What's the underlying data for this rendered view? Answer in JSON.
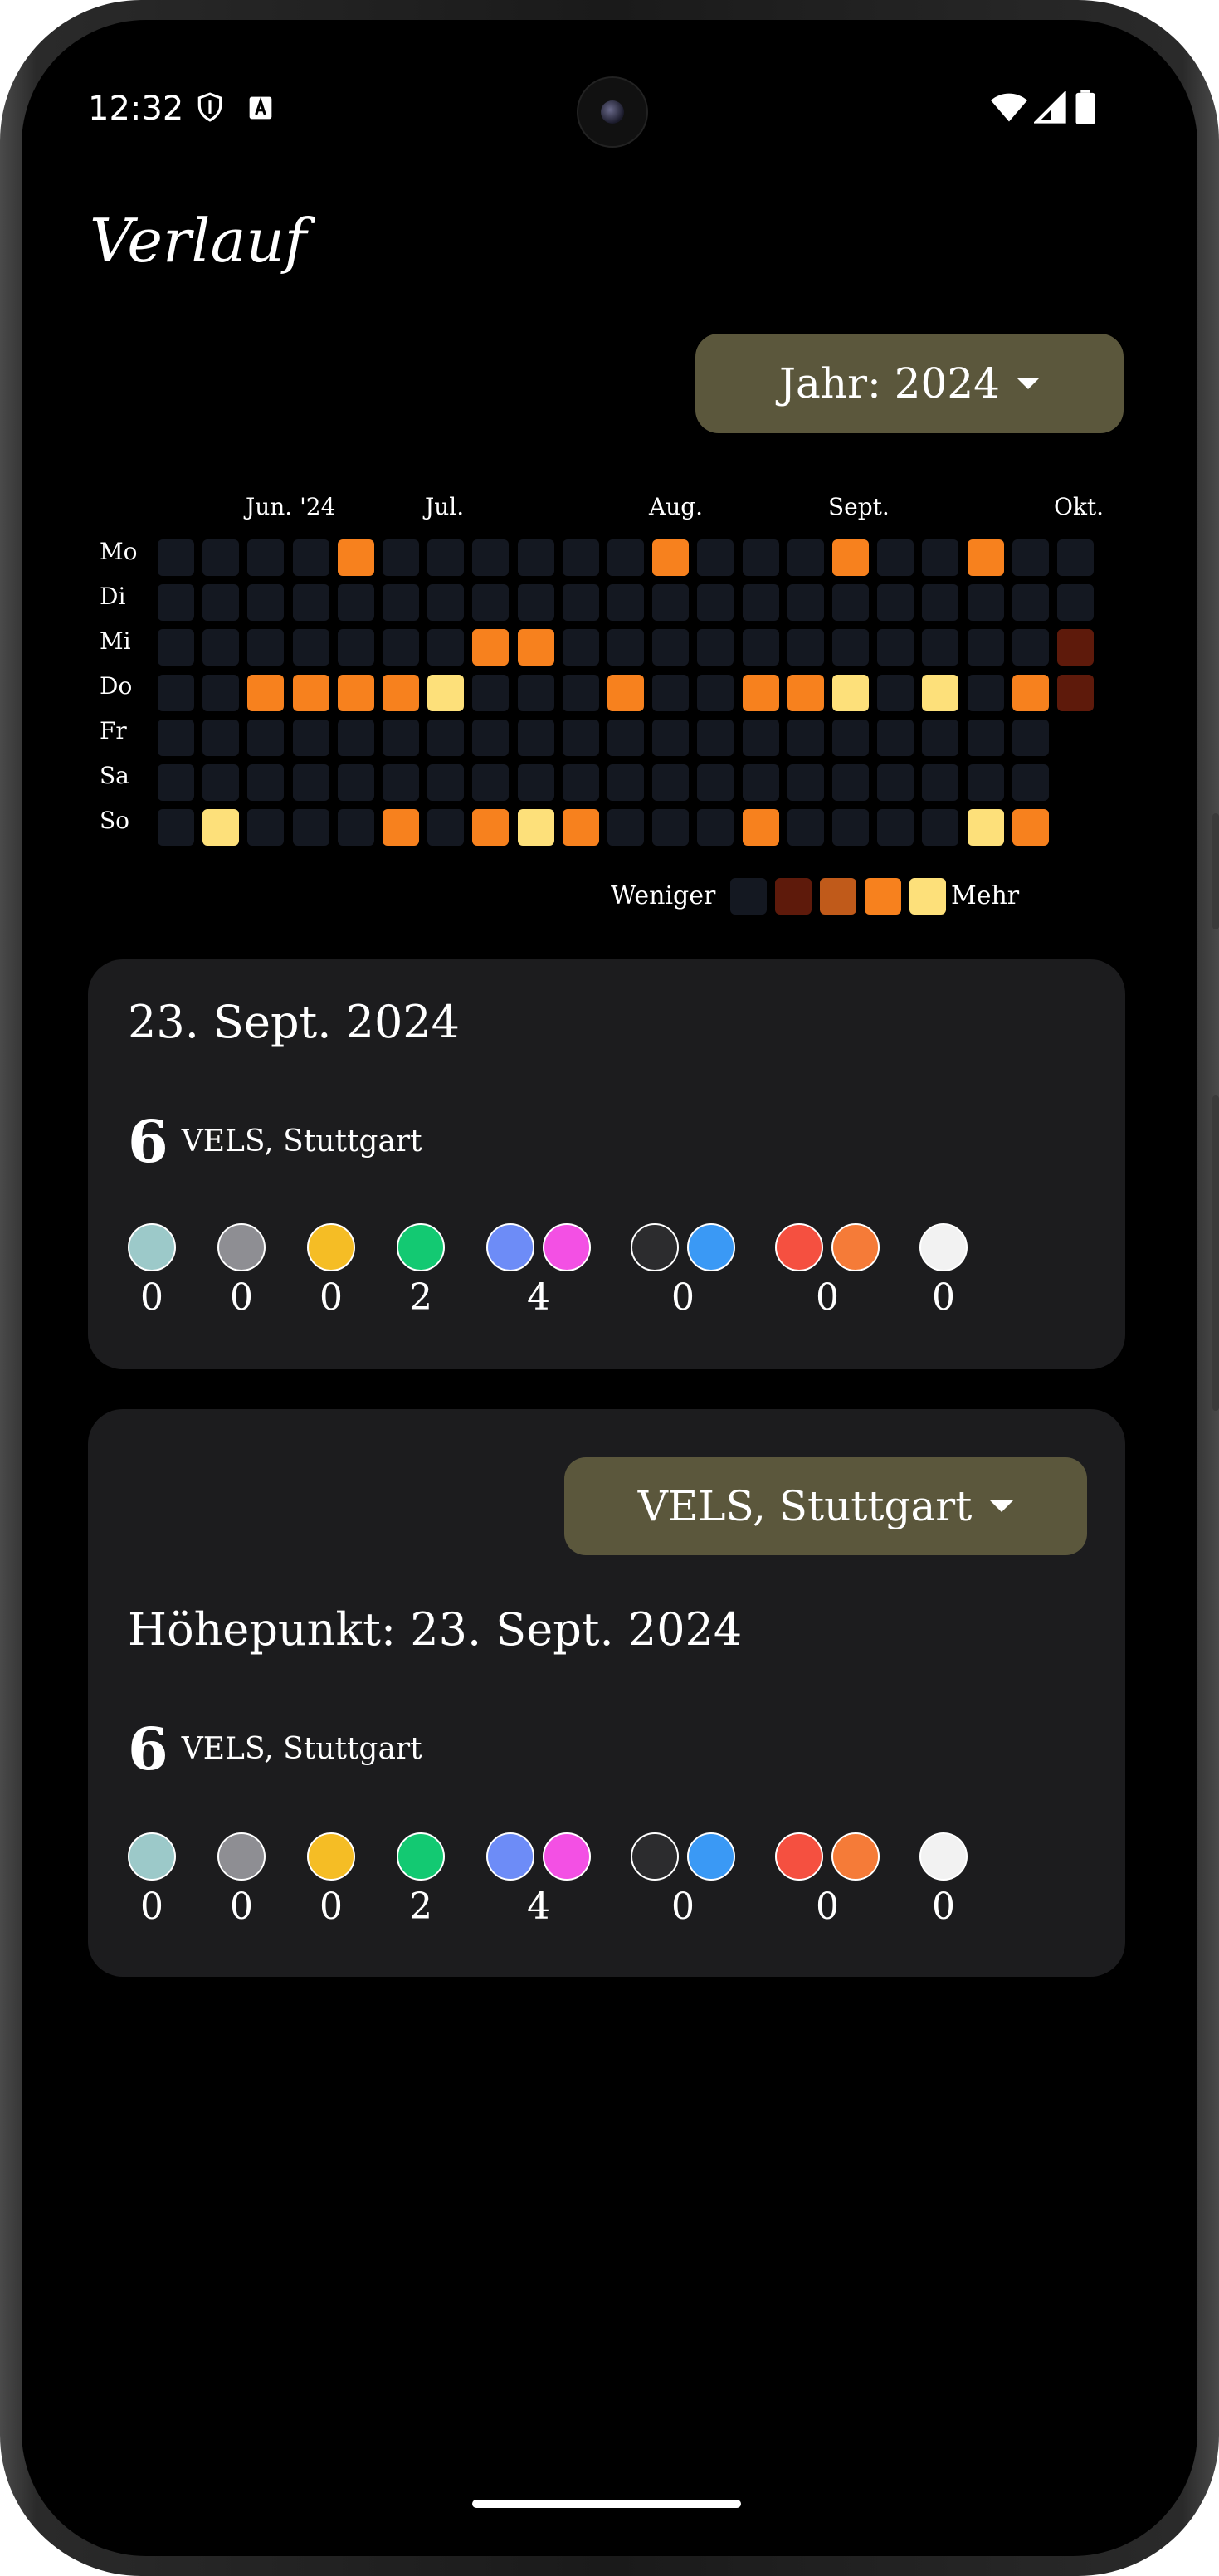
{
  "status_bar": {
    "time": "12:32"
  },
  "page": {
    "title": "Verlauf"
  },
  "year_selector": {
    "label": "Jahr: 2024"
  },
  "heatmap": {
    "months": [
      "Jun. '24",
      "Jul.",
      "Aug.",
      "Sept.",
      "Okt."
    ],
    "days": [
      "Mo",
      "Di",
      "Mi",
      "Do",
      "Fr",
      "Sa",
      "So"
    ],
    "legend": {
      "less": "Weniger",
      "more": "Mehr"
    },
    "colors": [
      "#141821",
      "#5e1a0b",
      "#c05a1a",
      "#f7811e",
      "#fde07a"
    ],
    "grid": [
      [
        0,
        0,
        0,
        0,
        3,
        0,
        0,
        0,
        0,
        0,
        0,
        3,
        0,
        0,
        0,
        3,
        0,
        0,
        3,
        0,
        0
      ],
      [
        0,
        0,
        0,
        0,
        0,
        0,
        0,
        0,
        0,
        0,
        0,
        0,
        0,
        0,
        0,
        0,
        0,
        0,
        0,
        0,
        0
      ],
      [
        0,
        0,
        0,
        0,
        0,
        0,
        0,
        3,
        3,
        0,
        0,
        0,
        0,
        0,
        0,
        0,
        0,
        0,
        0,
        0,
        1
      ],
      [
        0,
        0,
        3,
        3,
        3,
        3,
        4,
        0,
        0,
        0,
        3,
        0,
        0,
        3,
        3,
        4,
        0,
        4,
        0,
        3,
        1
      ],
      [
        0,
        0,
        0,
        0,
        0,
        0,
        0,
        0,
        0,
        0,
        0,
        0,
        0,
        0,
        0,
        0,
        0,
        0,
        0,
        0,
        -1
      ],
      [
        0,
        0,
        0,
        0,
        0,
        0,
        0,
        0,
        0,
        0,
        0,
        0,
        0,
        0,
        0,
        0,
        0,
        0,
        0,
        0,
        -1
      ],
      [
        0,
        4,
        0,
        0,
        0,
        3,
        0,
        3,
        4,
        3,
        0,
        0,
        0,
        3,
        0,
        0,
        0,
        0,
        4,
        3,
        -1
      ]
    ]
  },
  "day_card": {
    "date": "23. Sept. 2024",
    "location_count": "6",
    "location": "VELS, Stuttgart",
    "groups": [
      {
        "colors": [
          "#9cc9c9"
        ],
        "count": "0"
      },
      {
        "colors": [
          "#8e8e93"
        ],
        "count": "0"
      },
      {
        "colors": [
          "#f5bd25"
        ],
        "count": "0"
      },
      {
        "colors": [
          "#13c972"
        ],
        "count": "2"
      },
      {
        "colors": [
          "#6d8cf7",
          "#f350e4"
        ],
        "count": "4"
      },
      {
        "colors": [
          "#2c2c2e",
          "#3a99f5"
        ],
        "count": "0"
      },
      {
        "colors": [
          "#f55040",
          "#f57b38"
        ],
        "count": "0"
      },
      {
        "colors": [
          "#f2f2f2"
        ],
        "count": "0"
      }
    ]
  },
  "highlight_card": {
    "dropdown": "VELS, Stuttgart",
    "title": "Höhepunkt: 23. Sept. 2024",
    "location_count": "6",
    "location": "VELS, Stuttgart",
    "groups": [
      {
        "colors": [
          "#9cc9c9"
        ],
        "count": "0"
      },
      {
        "colors": [
          "#8e8e93"
        ],
        "count": "0"
      },
      {
        "colors": [
          "#f5bd25"
        ],
        "count": "0"
      },
      {
        "colors": [
          "#13c972"
        ],
        "count": "2"
      },
      {
        "colors": [
          "#6d8cf7",
          "#f350e4"
        ],
        "count": "4"
      },
      {
        "colors": [
          "#2c2c2e",
          "#3a99f5"
        ],
        "count": "0"
      },
      {
        "colors": [
          "#f55040",
          "#f57b38"
        ],
        "count": "0"
      },
      {
        "colors": [
          "#f2f2f2"
        ],
        "count": "0"
      }
    ]
  },
  "icons": [
    "shield-icon",
    "font-icon",
    "wifi-icon",
    "signal-icon",
    "battery-icon",
    "dropdown-caret-icon"
  ]
}
